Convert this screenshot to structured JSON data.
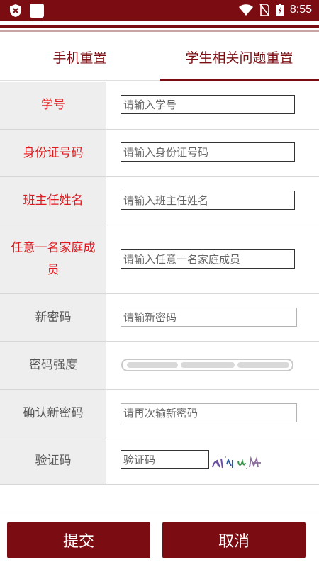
{
  "status_bar": {
    "time": "8:55",
    "icons": [
      "shield-icon",
      "notification-square-icon",
      "wifi-icon",
      "no-sim-icon",
      "battery-charging-icon"
    ]
  },
  "tabs": [
    {
      "label": "手机重置",
      "active": false
    },
    {
      "label": "学生相关问题重置",
      "active": true
    }
  ],
  "form": {
    "student_id": {
      "label": "学号",
      "placeholder": "请输入学号"
    },
    "id_card": {
      "label": "身份证号码",
      "placeholder": "请输入身份证号码"
    },
    "head_teacher": {
      "label": "班主任姓名",
      "placeholder": "请输入班主任姓名"
    },
    "family_member": {
      "label": "任意一名家庭成员",
      "placeholder": "请输入任意一名家庭成员"
    },
    "new_password": {
      "label": "新密码",
      "placeholder": "请输新密码"
    },
    "password_strength": {
      "label": "密码强度"
    },
    "confirm_password": {
      "label": "确认新密码",
      "placeholder": "请再次输新密码"
    },
    "captcha": {
      "label": "验证码",
      "placeholder": "验证码"
    }
  },
  "buttons": {
    "submit": "提交",
    "cancel": "取消"
  },
  "colors": {
    "brand": "#7b0d12",
    "required_label": "#e0191e",
    "optional_label": "#555555"
  }
}
